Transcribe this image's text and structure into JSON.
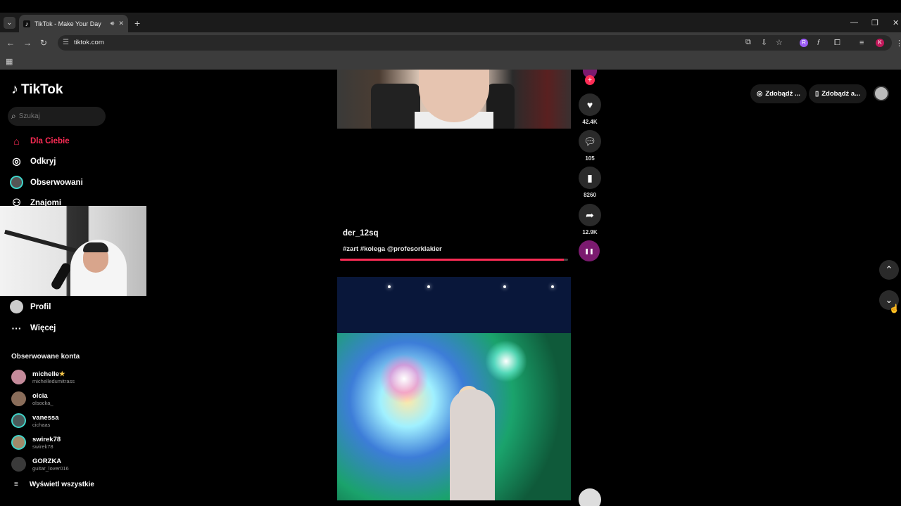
{
  "browser": {
    "tab_title": "TikTok - Make Your Day",
    "url": "tiktok.com"
  },
  "sidebar": {
    "logo": "TikTok",
    "search_placeholder": "Szukaj",
    "nav": [
      {
        "label": "Dla Ciebie",
        "icon": "home-icon",
        "active": true
      },
      {
        "label": "Odkryj",
        "icon": "compass-icon"
      },
      {
        "label": "Obserwowani",
        "icon": "avatar-ring-icon"
      },
      {
        "label": "Znajomi",
        "icon": "friends-icon"
      },
      {
        "label": "Profil",
        "icon": "profile-icon"
      },
      {
        "label": "Więcej",
        "icon": "more-icon"
      }
    ],
    "followed_title": "Obserwowane konta",
    "accounts": [
      {
        "name": "michelle",
        "handle": "michelledumitrass",
        "badge": "star-icon"
      },
      {
        "name": "olcia",
        "handle": "olsocka_"
      },
      {
        "name": "vanessa",
        "handle": "cichaas"
      },
      {
        "name": "swirek78",
        "handle": "swirek78"
      },
      {
        "name": "GORZKA",
        "handle": "guitar_lover016"
      }
    ],
    "show_all": "Wyświetl wszystkie"
  },
  "video": {
    "author": "der_12sq",
    "caption": "#zart #kolega @profesorklakier",
    "progress": 0.98,
    "actions": {
      "likes": "42.4K",
      "comments": "105",
      "saves": "8260",
      "shares": "12.9K"
    }
  },
  "header": {
    "get_coins": "Zdobądź ...",
    "get_app": "Zdobądź a..."
  },
  "colors": {
    "accent": "#fe2c55",
    "ring": "#3fd3c8"
  }
}
